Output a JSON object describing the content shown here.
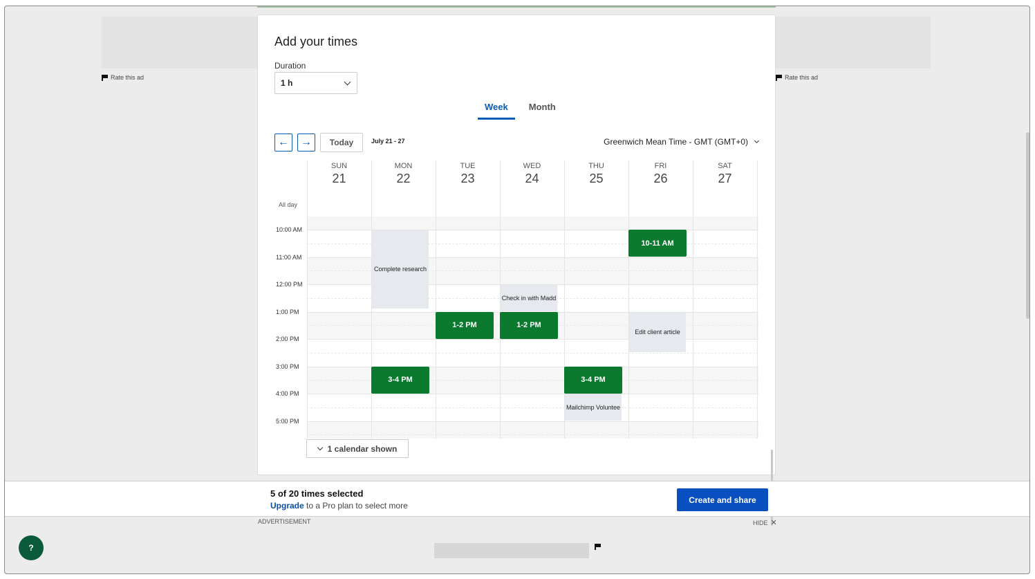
{
  "ads": {
    "rate_label": "Rate this ad",
    "advertisement_label": "ADVERTISEMENT",
    "hide_label": "HIDE",
    "hide_icon": "close-icon"
  },
  "modal": {
    "title": "Add your times",
    "duration_label": "Duration",
    "duration_value": "1 h",
    "tabs": [
      {
        "label": "Week",
        "active": true
      },
      {
        "label": "Month",
        "active": false
      }
    ],
    "today_label": "Today",
    "date_range": "July 21 - 27",
    "timezone": "Greenwich Mean Time - GMT (GMT+0)",
    "all_day_label": "All day",
    "calendars_shown": "1 calendar shown"
  },
  "days": [
    {
      "dow": "SUN",
      "num": "21"
    },
    {
      "dow": "MON",
      "num": "22"
    },
    {
      "dow": "TUE",
      "num": "23"
    },
    {
      "dow": "WED",
      "num": "24"
    },
    {
      "dow": "THU",
      "num": "25"
    },
    {
      "dow": "FRI",
      "num": "26"
    },
    {
      "dow": "SAT",
      "num": "27"
    }
  ],
  "times": [
    "10:00 AM",
    "11:00 AM",
    "12:00 PM",
    "1:00 PM",
    "2:00 PM",
    "3:00 PM",
    "4:00 PM",
    "5:00 PM"
  ],
  "selected_slots": [
    {
      "label": "10-11 AM",
      "day": 5,
      "start": 10,
      "end": 11
    },
    {
      "label": "1-2 PM",
      "day": 2,
      "start": 13,
      "end": 14
    },
    {
      "label": "1-2 PM",
      "day": 3,
      "start": 13,
      "end": 14
    },
    {
      "label": "3-4 PM",
      "day": 1,
      "start": 15,
      "end": 16
    },
    {
      "label": "3-4 PM",
      "day": 4,
      "start": 15,
      "end": 16
    }
  ],
  "busy_events": [
    {
      "label": "Complete research",
      "day": 1,
      "start": 10,
      "end": 12.9
    },
    {
      "label": "Check in with Madd",
      "day": 3,
      "start": 12,
      "end": 13
    },
    {
      "label": "Edit client article",
      "day": 5,
      "start": 13,
      "end": 14.5
    },
    {
      "label": "Mailchimp Voluntee",
      "day": 4,
      "start": 16,
      "end": 17
    }
  ],
  "footer": {
    "count": "5 of 20 times selected",
    "upgrade_link": "Upgrade",
    "upgrade_rest": " to a Pro plan to select more",
    "create_button": "Create and share",
    "help_label": "?"
  },
  "colors": {
    "accent": "#0a5bb5",
    "selected": "#0b7a2e",
    "busy": "#e6eaee",
    "help": "#0c5a3c"
  }
}
